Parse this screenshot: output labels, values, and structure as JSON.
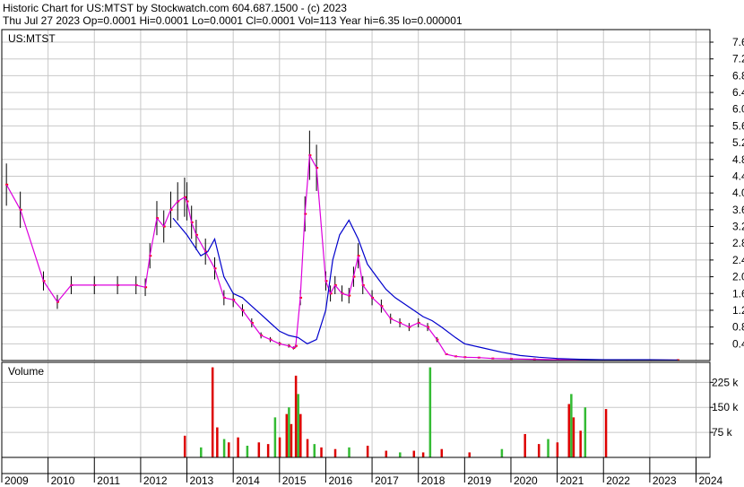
{
  "header": {
    "line1": "Historic Chart for US:MTST by Stockwatch.com 604.687.1500 - (c) 2023",
    "line2": "Thu Jul 27 2023   Op=0.0001   Hi=0.0001   Lo=0.0001   Cl=0.0001   Vol=113   Year hi=6.35   lo=0.000001"
  },
  "colors": {
    "frame": "#000000",
    "grid": "#c8c8c8",
    "price_bar": "#000000",
    "close_dot": "#ff0000",
    "ma_short": "#dd00dd",
    "ma_long": "#0000cc",
    "vol_up": "#33bb33",
    "vol_down": "#dd0000"
  },
  "chart_data": [
    {
      "type": "line",
      "title": "US:MTST",
      "y_ticks": [
        "7.60",
        "7.20",
        "6.80",
        "6.40",
        "6.00",
        "5.60",
        "5.20",
        "4.80",
        "4.40",
        "4.00",
        "3.60",
        "3.20",
        "2.80",
        "2.40",
        "2.00",
        "1.60",
        "1.20",
        "0.80",
        "0.40"
      ],
      "ylim": [
        0,
        7.9
      ],
      "x_ticks": [
        "2009",
        "2010",
        "2011",
        "2012",
        "2013",
        "2014",
        "2015",
        "2016",
        "2017",
        "2018",
        "2019",
        "2020",
        "2021",
        "2022",
        "2023",
        "2024"
      ],
      "x_range_years": [
        2009.0,
        2024.3
      ],
      "grid": true,
      "series": [
        {
          "x": [
            2009.1,
            2009.4,
            2009.9,
            2010.2,
            2010.5,
            2011.0,
            2011.5,
            2011.9,
            2012.1,
            2012.2,
            2012.35,
            2012.5,
            2012.65,
            2012.8,
            2012.95,
            2013.0,
            2013.1,
            2013.2,
            2013.4,
            2013.6,
            2013.8,
            2014.0,
            2014.2,
            2014.4,
            2014.6,
            2014.8,
            2015.0,
            2015.2,
            2015.3,
            2015.35,
            2015.45,
            2015.55,
            2015.65,
            2015.8,
            2016.0,
            2016.1,
            2016.2,
            2016.35,
            2016.5,
            2016.6,
            2016.7,
            2016.8,
            2017.0,
            2017.2,
            2017.4,
            2017.6,
            2017.8,
            2018.0,
            2018.2,
            2018.4,
            2018.6,
            2018.8,
            2019.0,
            2019.3,
            2019.6,
            2020.0,
            2020.5,
            2021.0,
            2021.5,
            2022.0,
            2022.5,
            2023.0,
            2023.6
          ],
          "y": [
            4.2,
            3.6,
            1.9,
            1.4,
            1.8,
            1.8,
            1.8,
            1.8,
            1.75,
            2.5,
            3.4,
            3.2,
            3.6,
            3.8,
            3.9,
            3.8,
            3.3,
            3.0,
            2.6,
            2.2,
            1.5,
            1.45,
            1.2,
            0.9,
            0.6,
            0.5,
            0.4,
            0.35,
            0.3,
            0.35,
            1.5,
            3.5,
            4.9,
            4.6,
            1.9,
            1.6,
            1.8,
            1.6,
            1.55,
            2.0,
            2.5,
            1.8,
            1.5,
            1.3,
            1.0,
            0.9,
            0.8,
            0.9,
            0.8,
            0.5,
            0.15,
            0.1,
            0.08,
            0.07,
            0.05,
            0.04,
            0.03,
            0.02,
            0.02,
            0.01,
            0.01,
            0.01,
            0.01
          ]
        },
        {
          "x": [
            2012.7,
            2013.0,
            2013.3,
            2013.45,
            2013.6,
            2013.8,
            2014.0,
            2014.2,
            2014.4,
            2014.6,
            2014.8,
            2015.0,
            2015.2,
            2015.4,
            2015.6,
            2015.8,
            2016.0,
            2016.15,
            2016.3,
            2016.5,
            2016.7,
            2016.9,
            2017.1,
            2017.3,
            2017.5,
            2017.7,
            2017.9,
            2018.1,
            2018.3,
            2018.5,
            2018.8,
            2019.0,
            2019.4,
            2019.8,
            2020.2,
            2020.6,
            2021.0,
            2021.5,
            2022.0,
            2022.5,
            2023.0,
            2023.6
          ],
          "y": [
            3.4,
            3.0,
            2.5,
            2.6,
            2.9,
            2.0,
            1.6,
            1.5,
            1.3,
            1.1,
            0.9,
            0.7,
            0.6,
            0.55,
            0.4,
            0.5,
            1.2,
            2.4,
            3.0,
            3.35,
            2.9,
            2.3,
            2.0,
            1.7,
            1.5,
            1.35,
            1.2,
            1.05,
            0.95,
            0.8,
            0.55,
            0.4,
            0.3,
            0.2,
            0.12,
            0.08,
            0.05,
            0.03,
            0.02,
            0.02,
            0.02,
            0.01
          ]
        }
      ]
    },
    {
      "type": "bar",
      "title": "Volume",
      "y_ticks": [
        "225 k",
        "150 k",
        "75 k"
      ],
      "ylim": [
        0,
        285000
      ],
      "x_range_years": [
        2009.0,
        2024.3
      ],
      "grid": true,
      "series": [
        {
          "x": [
            2012.95,
            2013.3,
            2013.55,
            2013.65,
            2013.8,
            2013.9,
            2014.1,
            2014.3,
            2014.55,
            2014.75,
            2014.9,
            2015.0,
            2015.15,
            2015.2,
            2015.25,
            2015.35,
            2015.4,
            2015.45,
            2015.6,
            2015.75,
            2015.9,
            2016.2,
            2016.5,
            2016.9,
            2017.3,
            2017.6,
            2017.9,
            2018.1,
            2018.25,
            2018.5,
            2019.1,
            2019.8,
            2020.3,
            2020.6,
            2020.8,
            2021.0,
            2021.25,
            2021.3,
            2021.35,
            2021.5,
            2021.6,
            2022.05
          ],
          "y": [
            65000,
            30000,
            270000,
            90000,
            55000,
            45000,
            60000,
            35000,
            45000,
            40000,
            120000,
            60000,
            130000,
            150000,
            100000,
            245000,
            190000,
            130000,
            55000,
            40000,
            30000,
            25000,
            30000,
            35000,
            20000,
            15000,
            20000,
            15000,
            270000,
            25000,
            15000,
            25000,
            70000,
            40000,
            55000,
            45000,
            160000,
            190000,
            120000,
            80000,
            150000,
            145000
          ]
        }
      ]
    }
  ]
}
